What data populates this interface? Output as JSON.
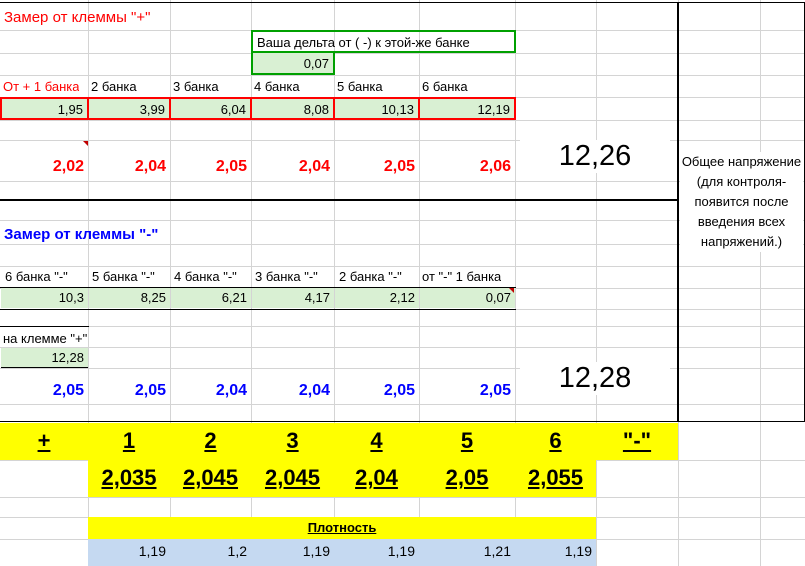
{
  "plus_section": {
    "title": "Замер от клеммы \"+\"",
    "delta_label": "Ваша дельта от ( -) к этой-же банке",
    "delta_value": "0,07",
    "headers": [
      "От + 1 банка",
      "2 банка",
      "3 банка",
      "4 банка",
      "5 банка",
      "6 банка"
    ],
    "values": [
      "1,95",
      "3,99",
      "6,04",
      "8,08",
      "10,13",
      "12,19"
    ],
    "cells": [
      "2,02",
      "2,04",
      "2,05",
      "2,04",
      "2,05",
      "2,06"
    ],
    "total": "12,26"
  },
  "side_note": "Общее напряжение (для контроля- появится после введения всех напряжений.)",
  "minus_section": {
    "title": "Замер от клеммы \"-\"",
    "headers": [
      "6  банка \"-\"",
      "5  банка \"-\"",
      "4 банка \"-\"",
      "3  банка \"-\"",
      "2  банка \"-\"",
      "от \"-\"  1  банка"
    ],
    "values": [
      "10,3",
      "8,25",
      "6,21",
      "4,17",
      "2,12",
      "0,07"
    ],
    "terminal_label": "на клемме \"+\"",
    "terminal_value": "12,28",
    "cells": [
      "2,05",
      "2,05",
      "2,04",
      "2,04",
      "2,05",
      "2,05"
    ],
    "total": "12,28"
  },
  "summary": {
    "headers": [
      "+",
      "1",
      "2",
      "3",
      "4",
      "5",
      "6",
      "\"-\""
    ],
    "values": [
      "2,035",
      "2,045",
      "2,045",
      "2,04",
      "2,05",
      "2,055"
    ],
    "density_label": "Плотность",
    "density": [
      "1,19",
      "1,2",
      "1,19",
      "1,19",
      "1,21",
      "1,19"
    ]
  },
  "colors": {
    "red": "#ff0000",
    "blue": "#0000ff",
    "cell_green": "#d9f0d3",
    "yellow": "#ffff00",
    "light_blue": "#c5d9f1",
    "border_green": "#00a000",
    "border_red": "#ff0000"
  }
}
